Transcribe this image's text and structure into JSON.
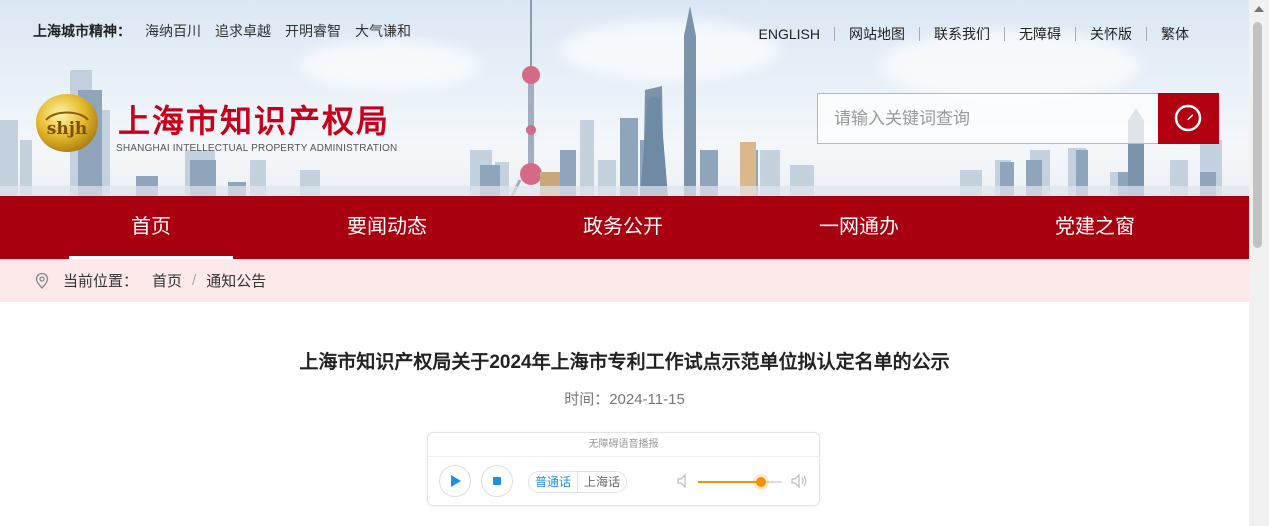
{
  "header": {
    "spirit_label": "上海城市精神：",
    "spirit_items": [
      "海纳百川",
      "追求卓越",
      "开明睿智",
      "大气谦和"
    ],
    "links": [
      "ENGLISH",
      "网站地图",
      "联系我们",
      "无障碍",
      "关怀版",
      "繁体"
    ],
    "title": "上海市知识产权局",
    "subtitle": "SHANGHAI INTELLECTUAL PROPERTY ADMINISTRATION",
    "search_placeholder": "请输入关键词查询",
    "logo_text": "shjh"
  },
  "nav": {
    "items": [
      "首页",
      "要闻动态",
      "政务公开",
      "一网通办",
      "党建之窗"
    ],
    "active_index": 0
  },
  "breadcrumb": {
    "label": "当前位置：",
    "items": [
      "首页",
      "通知公告"
    ]
  },
  "article": {
    "title": "上海市知识产权局关于2024年上海市专利工作试点示范单位拟认定名单的公示",
    "time": "时间：2024-11-15"
  },
  "player": {
    "header": "无障碍语音播报",
    "lang_options": [
      "普通话",
      "上海话"
    ],
    "selected_lang": "普通话",
    "volume": 0.75
  },
  "colors": {
    "brand_red": "#a8000f",
    "title_red": "#c6001a",
    "breadcrumb_bg": "#fde9ea",
    "accent_blue": "#1e8fe6",
    "volume_orange": "#f39200"
  },
  "icons": {
    "search": "search-icon",
    "location": "location-pin-icon",
    "play": "play-icon",
    "stop": "stop-icon",
    "volume_low": "volume-low-icon",
    "volume_high": "volume-high-icon"
  }
}
